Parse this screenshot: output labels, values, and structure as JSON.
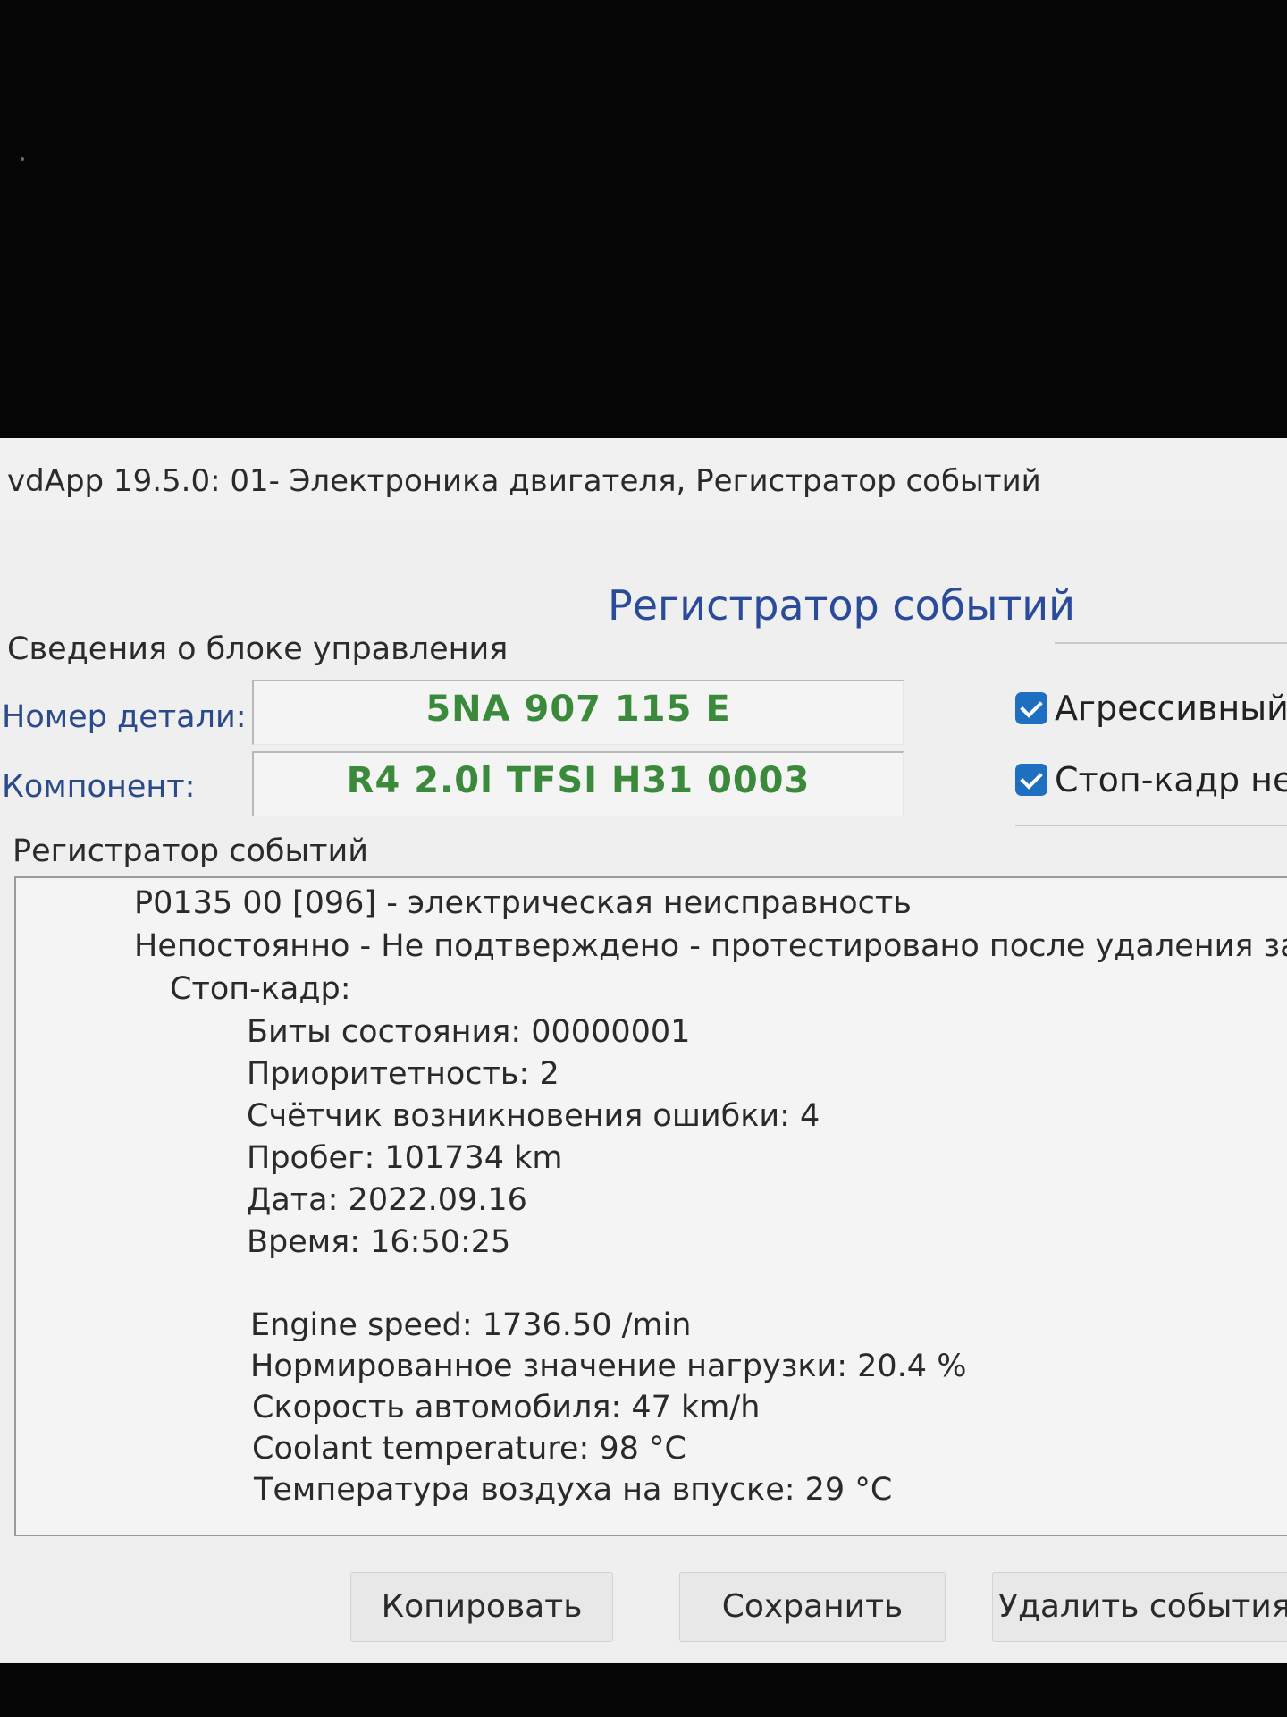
{
  "window": {
    "title": "vdApp 19.5.0: 01- Электроника двигателя,  Регистратор событий"
  },
  "dialog": {
    "title": "Регистратор событий"
  },
  "ecu_info": {
    "group_label": "Сведения о блоке управления",
    "part_number_label": "Номер детали:",
    "part_number_value": "5NA 907 115 E",
    "component_label": "Компонент:",
    "component_value": "R4 2.0l TFSI  H31 0003"
  },
  "options": [
    {
      "label": "Агрессивный",
      "checked": true
    },
    {
      "label": "Стоп-кадр неи",
      "checked": true
    }
  ],
  "event_log": {
    "group_label": "Регистратор событий",
    "lines": [
      "P0135 00 [096] - электрическая неисправность",
      "Непостоянно - Не подтверждено - протестировано после удаления за",
      "Стоп-кадр:",
      "Биты состояния: 00000001",
      "Приоритетность: 2",
      "Счётчик возникновения ошибки: 4",
      "Пробег: 101734 km",
      "Дата: 2022.09.16",
      "Время: 16:50:25",
      "Engine speed: 1736.50 /min",
      "Нормированное значение нагрузки: 20.4 %",
      "Скорость автомобиля: 47 km/h",
      "Coolant temperature: 98 °C",
      "Температура воздуха на впуске: 29 °C"
    ]
  },
  "buttons": {
    "copy": "Копировать",
    "save": "Сохранить",
    "delete": "Удалить события"
  },
  "colors": {
    "value_green": "#3b8a3b",
    "label_blue": "#2b4a8a",
    "title_blue": "#2a4a9a",
    "checkbox_blue": "#1f6fc1"
  }
}
